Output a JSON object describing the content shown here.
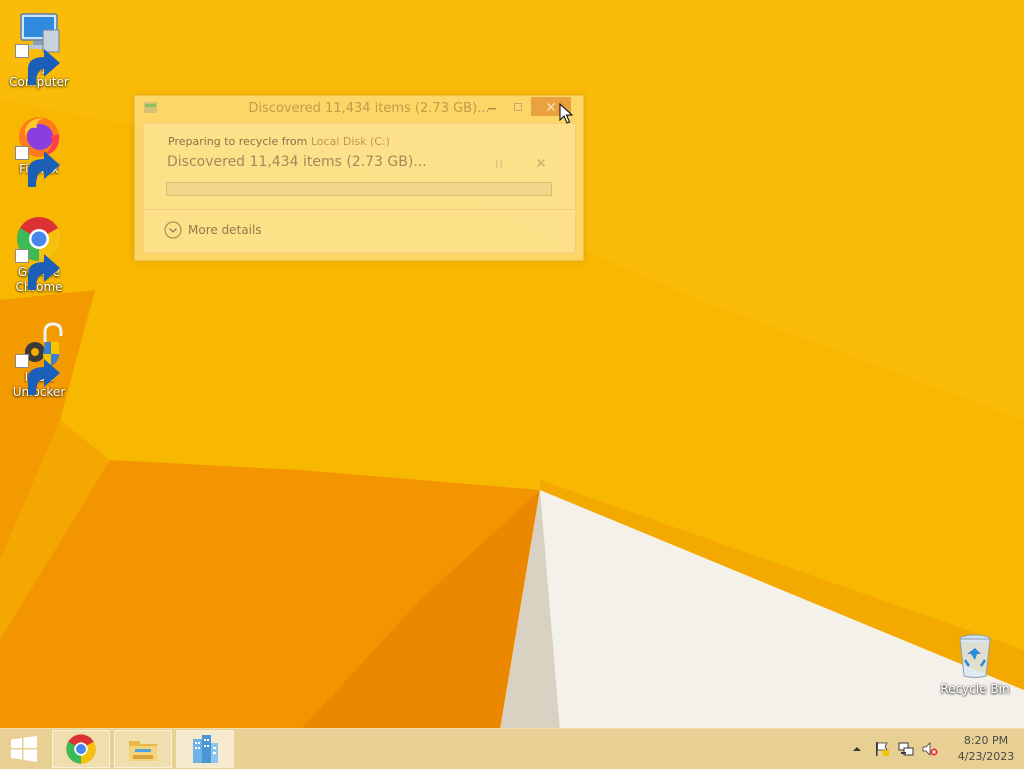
{
  "desktop": {
    "icons": [
      {
        "label": "My Computer",
        "icon": "computer-icon"
      },
      {
        "label": "Firefox",
        "icon": "firefox-icon"
      },
      {
        "label": "Google Chrome",
        "icon": "chrome-icon"
      },
      {
        "label": "IObit Unlocker",
        "icon": "iobit-unlocker-icon"
      },
      {
        "label": "Recycle Bin",
        "icon": "recycle-bin-icon"
      }
    ]
  },
  "dialog": {
    "title": "Discovered 11,434 items (2.73 GB)...",
    "preparing_prefix": "Preparing to recycle from ",
    "source": "Local Disk (C:)",
    "status": "Discovered 11,434 items (2.73 GB)...",
    "progress": 0,
    "more_details_label": "More details"
  },
  "taskbar": {
    "apps": [
      {
        "name": "Google Chrome",
        "icon": "chrome-icon"
      },
      {
        "name": "File Explorer",
        "icon": "folder-icon"
      },
      {
        "name": "Delete progress",
        "icon": "building-app-icon",
        "active": true
      }
    ],
    "tray_icons": [
      "show-hidden-icons-arrow",
      "action-center-flag-icon",
      "network-icon",
      "volume-muted-icon"
    ],
    "clock": {
      "time": "8:20 PM",
      "date": "4/23/2023"
    }
  },
  "colors": {
    "wallpaper": "#f7b500",
    "wallpaper_dark": "#f08c00",
    "taskbar": "#e8cf93"
  }
}
